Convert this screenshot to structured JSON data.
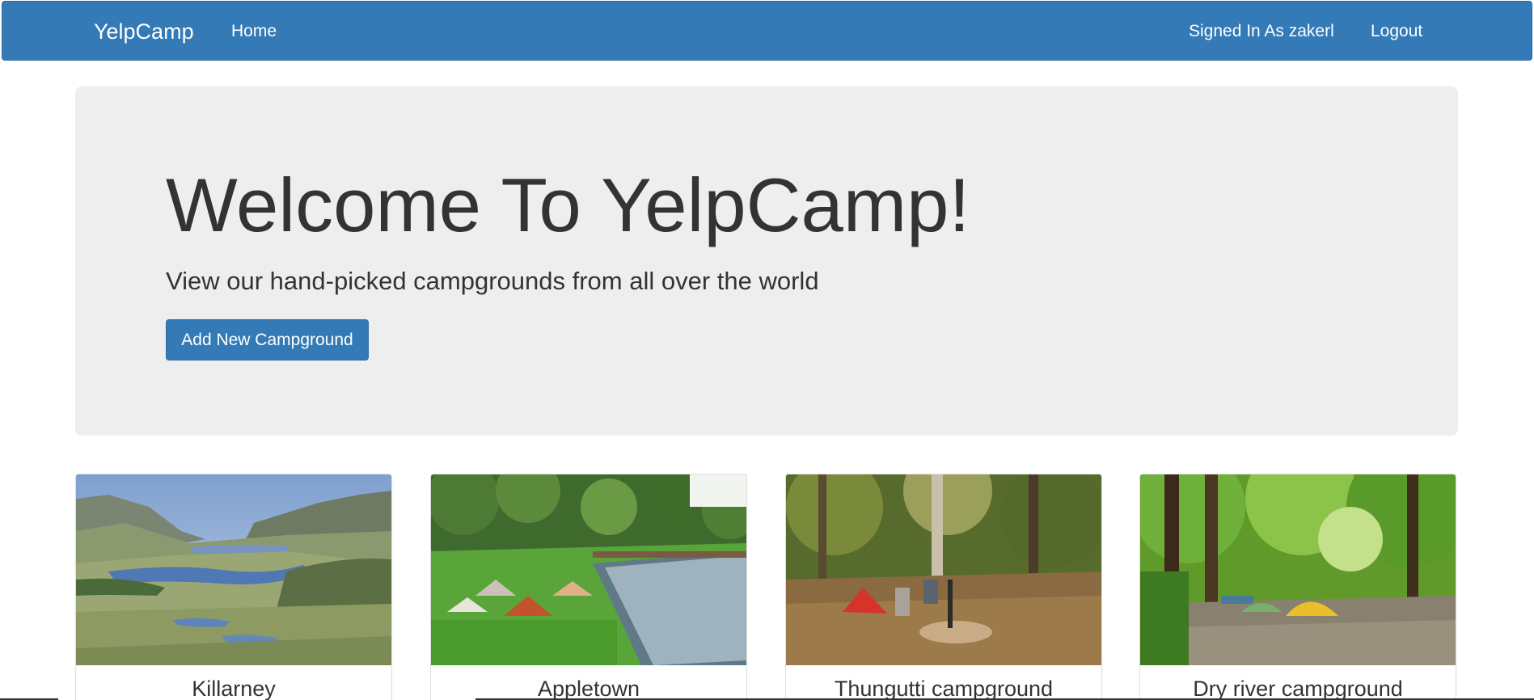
{
  "navbar": {
    "brand": "YelpCamp",
    "home_label": "Home",
    "signed_in_label": "Signed In As zakerl",
    "logout_label": "Logout",
    "background_color": "#337ab7"
  },
  "jumbotron": {
    "title": "Welcome To YelpCamp!",
    "subtitle": "View our hand-picked campgrounds from all over the world",
    "add_button_label": "Add New Campground"
  },
  "campgrounds": [
    {
      "name": "Killarney",
      "image": "mountain-lake-landscape"
    },
    {
      "name": "Appletown",
      "image": "tents-by-river"
    },
    {
      "name": "Thungutti campground",
      "image": "campers-at-campfire-in-forest"
    },
    {
      "name": "Dry river campground",
      "image": "tents-in-green-forest"
    }
  ]
}
